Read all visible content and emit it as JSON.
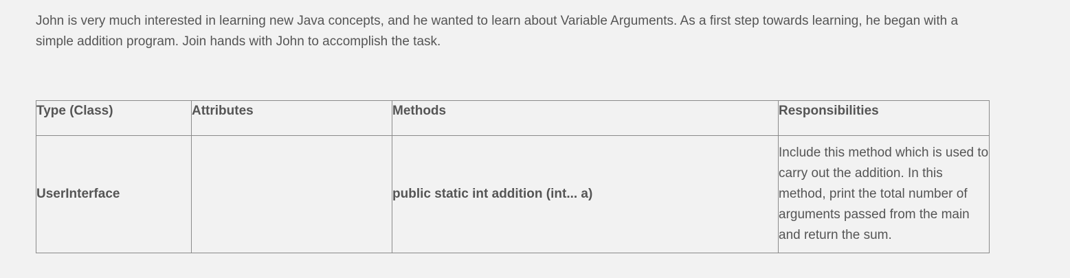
{
  "intro": {
    "text": "John is very much interested in learning new Java concepts, and he wanted to learn about Variable Arguments. As a first step towards learning, he began with a simple addition program. Join hands with John to accomplish the task."
  },
  "table": {
    "headers": [
      "Type (Class)",
      "Attributes",
      "Methods",
      "Responsibilities"
    ],
    "rows": [
      {
        "type": "UserInterface",
        "attributes": "",
        "methods": "public static int addition (int... a)",
        "responsibilities": "Include this method which is used to carry out the addition. In this method, print the total number of arguments passed from the main and return the sum."
      }
    ]
  }
}
